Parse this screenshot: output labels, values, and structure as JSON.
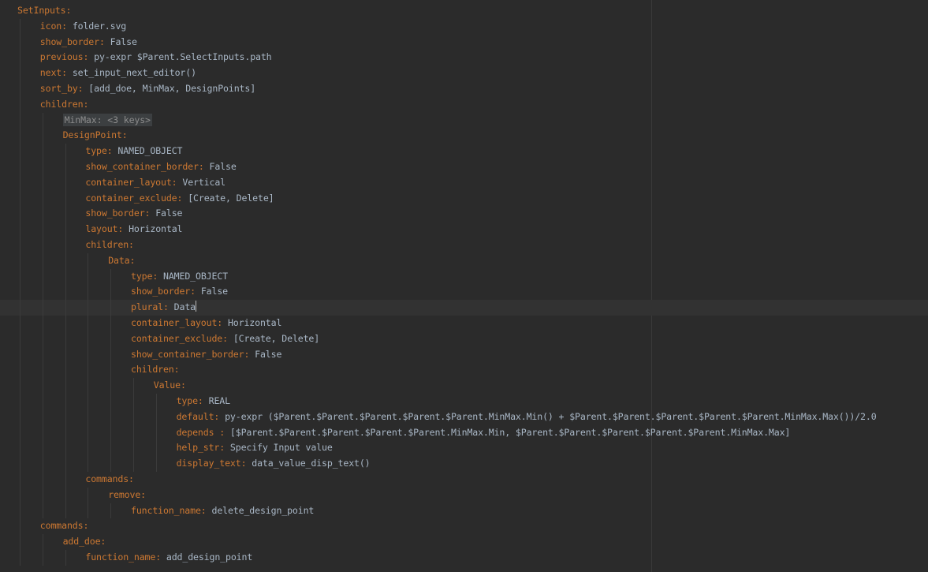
{
  "lines": [
    {
      "indent": 0,
      "key": "SetInputs",
      "value": ""
    },
    {
      "indent": 1,
      "key": "icon",
      "value": "folder.svg"
    },
    {
      "indent": 1,
      "key": "show_border",
      "value": "False"
    },
    {
      "indent": 1,
      "key": "previous",
      "value": "py-expr $Parent.SelectInputs.path"
    },
    {
      "indent": 1,
      "key": "next",
      "value": "set_input_next_editor()"
    },
    {
      "indent": 1,
      "key": "sort_by",
      "value": "[add_doe, MinMax, DesignPoints]"
    },
    {
      "indent": 1,
      "key": "children",
      "value": ""
    },
    {
      "indent": 2,
      "folded": true,
      "key": "MinMax",
      "value": "<3 keys>"
    },
    {
      "indent": 2,
      "key": "DesignPoint",
      "value": ""
    },
    {
      "indent": 3,
      "key": "type",
      "value": "NAMED_OBJECT"
    },
    {
      "indent": 3,
      "key": "show_container_border",
      "value": "False"
    },
    {
      "indent": 3,
      "key": "container_layout",
      "value": "Vertical"
    },
    {
      "indent": 3,
      "key": "container_exclude",
      "value": "[Create, Delete]"
    },
    {
      "indent": 3,
      "key": "show_border",
      "value": "False"
    },
    {
      "indent": 3,
      "key": "layout",
      "value": "Horizontal"
    },
    {
      "indent": 3,
      "key": "children",
      "value": ""
    },
    {
      "indent": 4,
      "key": "Data",
      "value": ""
    },
    {
      "indent": 5,
      "key": "type",
      "value": "NAMED_OBJECT"
    },
    {
      "indent": 5,
      "key": "show_border",
      "value": "False"
    },
    {
      "indent": 5,
      "key": "plural",
      "value": "Data",
      "current": true
    },
    {
      "indent": 5,
      "key": "container_layout",
      "value": "Horizontal"
    },
    {
      "indent": 5,
      "key": "container_exclude",
      "value": "[Create, Delete]"
    },
    {
      "indent": 5,
      "key": "show_container_border",
      "value": "False"
    },
    {
      "indent": 5,
      "key": "children",
      "value": ""
    },
    {
      "indent": 6,
      "key": "Value",
      "value": ""
    },
    {
      "indent": 7,
      "key": "type",
      "value": "REAL"
    },
    {
      "indent": 7,
      "key": "default",
      "value": "py-expr ($Parent.$Parent.$Parent.$Parent.$Parent.MinMax.Min() + $Parent.$Parent.$Parent.$Parent.$Parent.MinMax.Max())/2.0"
    },
    {
      "indent": 7,
      "key": "depends ",
      "value": "[$Parent.$Parent.$Parent.$Parent.$Parent.MinMax.Min, $Parent.$Parent.$Parent.$Parent.$Parent.MinMax.Max]"
    },
    {
      "indent": 7,
      "key": "help_str",
      "value": "Specify Input value"
    },
    {
      "indent": 7,
      "key": "display_text",
      "value": "data_value_disp_text()"
    },
    {
      "indent": 3,
      "key": "commands",
      "value": ""
    },
    {
      "indent": 4,
      "key": "remove",
      "value": ""
    },
    {
      "indent": 5,
      "key": "function_name",
      "value": "delete_design_point"
    },
    {
      "indent": 1,
      "key": "commands",
      "value": ""
    },
    {
      "indent": 2,
      "key": "add_doe",
      "value": ""
    },
    {
      "indent": 3,
      "key": "function_name",
      "value": "add_design_point"
    }
  ],
  "colors": {
    "background": "#2b2b2b",
    "key": "#cc7832",
    "value": "#a9b7c6",
    "current_line": "#323232",
    "fold_background": "#3c3f41"
  }
}
